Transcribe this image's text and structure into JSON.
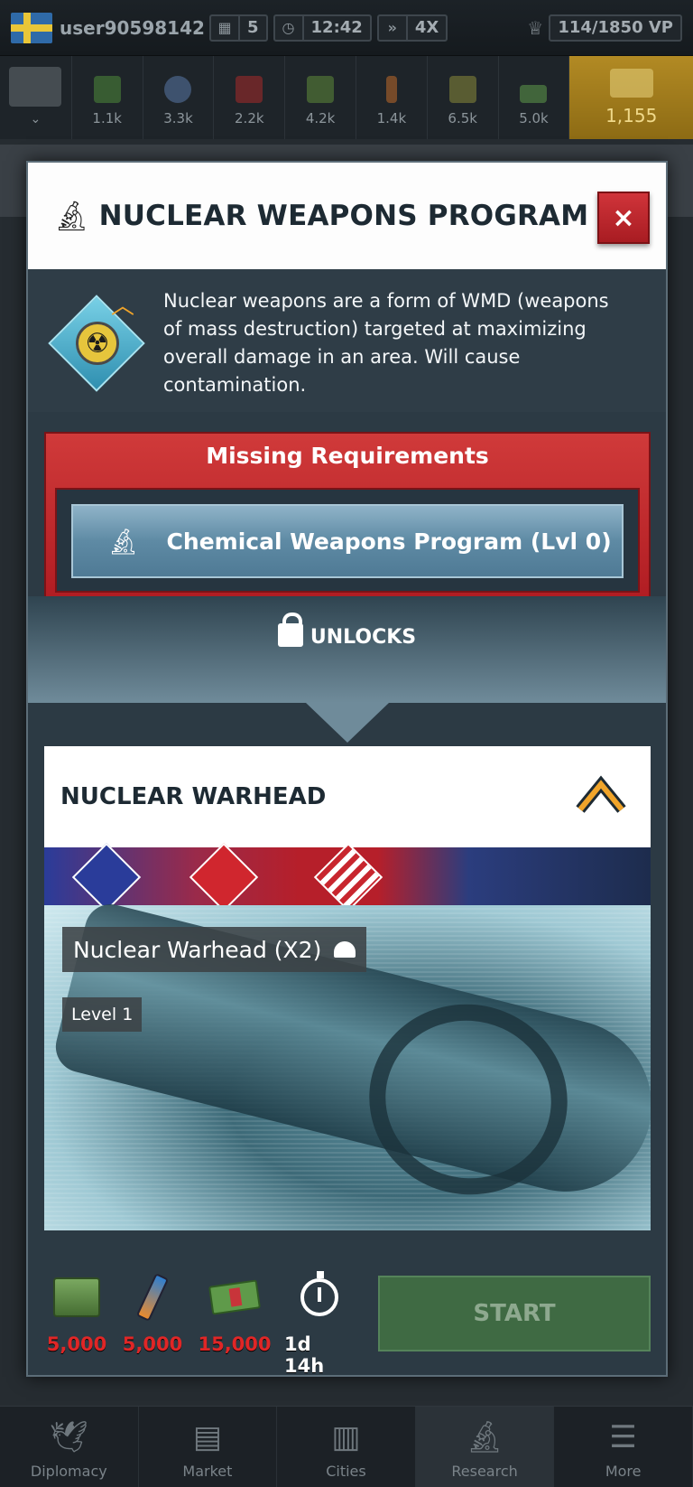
{
  "status_bar": {
    "username": "user90598142",
    "calendar_value": "5",
    "clock_value": "12:42",
    "speed_value": "4X",
    "victory_points": "114/1850 VP"
  },
  "resources": [
    {
      "value": "",
      "icon": "army-selector-icon"
    },
    {
      "value": "1.1k",
      "icon": "supplies-icon"
    },
    {
      "value": "3.3k",
      "icon": "components-icon"
    },
    {
      "value": "2.2k",
      "icon": "fuel-icon"
    },
    {
      "value": "4.2k",
      "icon": "electronics-icon"
    },
    {
      "value": "1.4k",
      "icon": "rare-materials-icon"
    },
    {
      "value": "6.5k",
      "icon": "manpower-icon"
    },
    {
      "value": "5.0k",
      "icon": "money-icon"
    },
    {
      "value": "1,155",
      "icon": "gold-icon"
    }
  ],
  "modal": {
    "title": "NUCLEAR WEAPONS PROGRAM",
    "close_label": "×",
    "description": "Nuclear weapons are a form of WMD (weapons of mass destruction) targeted at maximizing overall damage in an area. Will cause contamination.",
    "requirements": {
      "title": "Missing Requirements",
      "item": "Chemical Weapons Program (Lvl 0)"
    },
    "unlocks_label": "UNLOCKS",
    "unit": {
      "title": "NUCLEAR WARHEAD",
      "name_tag": "Nuclear Warhead (X2)",
      "level": "Level 1"
    },
    "costs": [
      {
        "icon": "supplies-crate-icon",
        "value": "5,000"
      },
      {
        "icon": "rare-materials-icon",
        "value": "5,000"
      },
      {
        "icon": "money-icon",
        "value": "15,000"
      },
      {
        "icon": "stopwatch-icon",
        "value": "1d 14h"
      }
    ],
    "start_label": "START"
  },
  "nav": [
    {
      "label": "Diplomacy",
      "icon": "dove-icon"
    },
    {
      "label": "Market",
      "icon": "basket-icon"
    },
    {
      "label": "Cities",
      "icon": "city-icon"
    },
    {
      "label": "Research",
      "icon": "microscope-icon"
    },
    {
      "label": "More",
      "icon": "menu-icon"
    }
  ],
  "colors": {
    "accent_red": "#c0282e",
    "start_green": "#3f6a43",
    "cost_red": "#e02626",
    "gold": "#b28a24"
  }
}
